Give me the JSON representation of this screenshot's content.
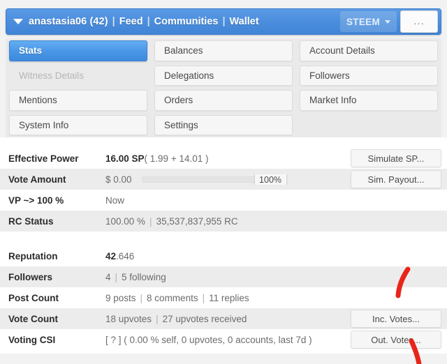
{
  "navbar": {
    "user": "anastasia06 (42)",
    "separator": "|",
    "links": [
      {
        "label": "Feed"
      },
      {
        "label": "Communities"
      },
      {
        "label": "Wallet"
      }
    ],
    "chain_selector": {
      "label": "STEEM"
    },
    "more_button": {
      "label": "..."
    },
    "accent_color": "#4a8ddd"
  },
  "tabs": [
    {
      "label": "Stats",
      "state": "active"
    },
    {
      "label": "Balances",
      "state": "normal"
    },
    {
      "label": "Account Details",
      "state": "normal"
    },
    {
      "label": "Witness Details",
      "state": "disabled"
    },
    {
      "label": "Delegations",
      "state": "normal"
    },
    {
      "label": "Followers",
      "state": "normal"
    },
    {
      "label": "Mentions",
      "state": "normal"
    },
    {
      "label": "Orders",
      "state": "normal"
    },
    {
      "label": "Market Info",
      "state": "normal"
    },
    {
      "label": "System Info",
      "state": "normal"
    },
    {
      "label": "Settings",
      "state": "normal"
    },
    {
      "label": "",
      "state": "empty"
    }
  ],
  "stats_top": [
    {
      "label": "Effective Power",
      "value_strong": "16.00 SP",
      "value_rest": " ( 1.99 + 14.01 )",
      "button": "Simulate SP..."
    },
    {
      "label": "Vote Amount",
      "value_strong": "$ 0.00",
      "slider_value": "100%",
      "button": "Sim. Payout..."
    },
    {
      "label": "VP ~> 100 %",
      "value_plain": "Now"
    },
    {
      "label": "RC Status",
      "value_plain": "100.00 %",
      "value_pipe": "|",
      "value_tail": "35,537,837,955 RC"
    }
  ],
  "stats_bottom": [
    {
      "label": "Reputation",
      "value_strong": "42",
      "value_rest": ".646"
    },
    {
      "label": "Followers",
      "value_plain": "4",
      "value_pipe": "|",
      "value_tail": "5 following"
    },
    {
      "label": "Post Count",
      "value_plain": "9 posts",
      "value_pipe": "|",
      "value_mid": "8 comments",
      "value_pipe2": "|",
      "value_tail": "11 replies"
    },
    {
      "label": "Vote Count",
      "value_plain": "18 upvotes",
      "value_pipe": "|",
      "value_tail": "27 upvotes received",
      "button": "Inc. Votes..."
    },
    {
      "label": "Voting CSI",
      "value_plain": "[ ? ] ( 0.00 % self, 0 upvotes, 0 accounts, last 7d )",
      "button": "Out. Votes..."
    }
  ],
  "annotations": {
    "color": "#e8251a",
    "marks": [
      {
        "name": "stroke-upper"
      },
      {
        "name": "stroke-lower"
      }
    ]
  }
}
